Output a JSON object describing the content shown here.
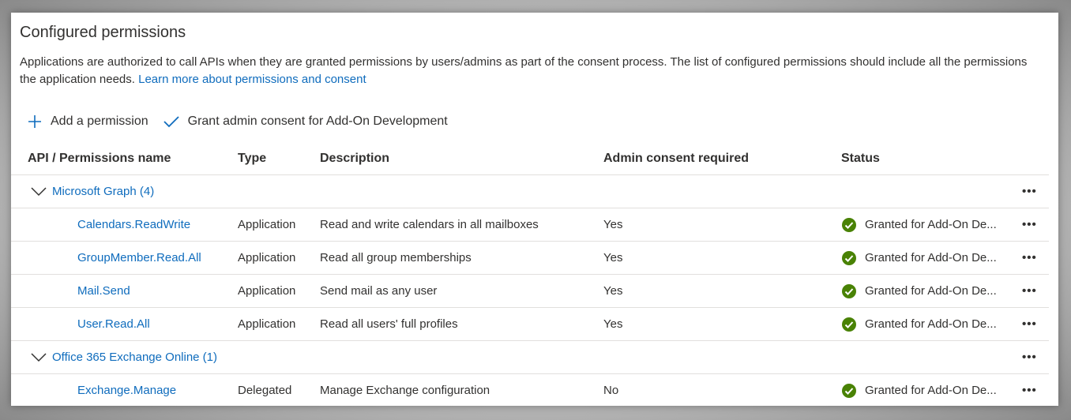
{
  "title": "Configured permissions",
  "description": {
    "text": "Applications are authorized to call APIs when they are granted permissions by users/admins as part of the consent process. The list of configured permissions should include all the permissions the application needs.",
    "link": "Learn more about permissions and consent"
  },
  "toolbar": {
    "add_label": "Add a permission",
    "grant_label": "Grant admin consent for Add-On Development"
  },
  "table": {
    "headers": {
      "name": "API / Permissions name",
      "type": "Type",
      "description": "Description",
      "admin": "Admin consent required",
      "status": "Status"
    },
    "more_label": "•••",
    "groups": [
      {
        "name": "Microsoft Graph (4)",
        "permissions": [
          {
            "name": "Calendars.ReadWrite",
            "type": "Application",
            "description": "Read and write calendars in all mailboxes",
            "admin": "Yes",
            "status": "Granted for Add-On De..."
          },
          {
            "name": "GroupMember.Read.All",
            "type": "Application",
            "description": "Read all group memberships",
            "admin": "Yes",
            "status": "Granted for Add-On De..."
          },
          {
            "name": "Mail.Send",
            "type": "Application",
            "description": "Send mail as any user",
            "admin": "Yes",
            "status": "Granted for Add-On De..."
          },
          {
            "name": "User.Read.All",
            "type": "Application",
            "description": "Read all users' full profiles",
            "admin": "Yes",
            "status": "Granted for Add-On De..."
          }
        ]
      },
      {
        "name": "Office 365 Exchange Online (1)",
        "permissions": [
          {
            "name": "Exchange.Manage",
            "type": "Delegated",
            "description": "Manage Exchange configuration",
            "admin": "No",
            "status": "Granted for Add-On De..."
          }
        ]
      }
    ]
  },
  "colors": {
    "accent": "#0f6cbd",
    "success": "#498205",
    "text": "#323130",
    "divider": "#e1dfdd"
  },
  "icons": {
    "add": "plus-icon",
    "grant": "checkmark-icon",
    "expand": "chevron-down-icon",
    "status": "check-circle-icon",
    "more": "more-icon"
  }
}
